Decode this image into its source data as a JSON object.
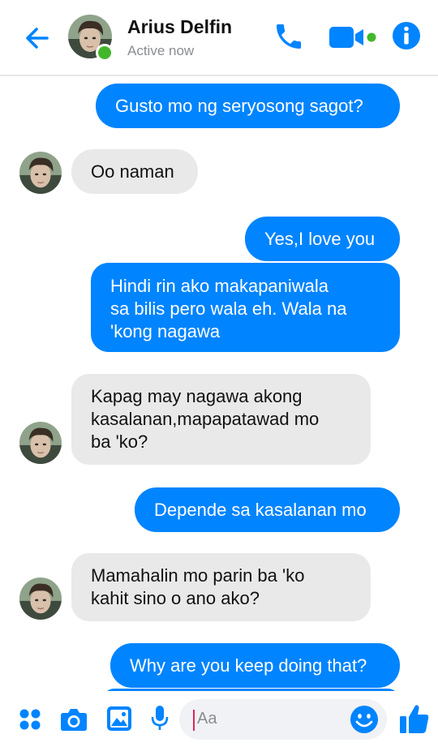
{
  "header": {
    "contact_name": "Arius Delfin",
    "status": "Active now",
    "icons": [
      "back-arrow-icon",
      "phone-icon",
      "video-camera-icon",
      "info-icon"
    ]
  },
  "messages": [
    {
      "direction": "outgoing",
      "text": "Gusto mo ng seryosong sagot?"
    },
    {
      "direction": "incoming",
      "text": "Oo naman"
    },
    {
      "direction": "outgoing",
      "text": "Yes,I love you"
    },
    {
      "direction": "outgoing",
      "text": "Hindi rin ako makapaniwala\nsa bilis pero wala eh. Wala na\n'kong nagawa"
    },
    {
      "direction": "incoming",
      "text": "Kapag may nagawa akong\nkasalanan,mapapatawad mo\nba 'ko?"
    },
    {
      "direction": "outgoing",
      "text": "Depende sa kasalanan mo"
    },
    {
      "direction": "incoming",
      "text": "Mamahalin mo parin ba 'ko\nkahit sino o ano ako?"
    },
    {
      "direction": "outgoing",
      "text": "Why are you keep doing that?"
    }
  ],
  "composer": {
    "placeholder": "Aa",
    "icons": [
      "menu-dots-icon",
      "camera-icon",
      "gallery-icon",
      "microphone-icon",
      "emoji-icon",
      "thumbs-up-icon"
    ]
  },
  "colors": {
    "accent": "#0084ff",
    "incoming_bubble": "#e9e9ea",
    "active_dot": "#42b72a"
  }
}
